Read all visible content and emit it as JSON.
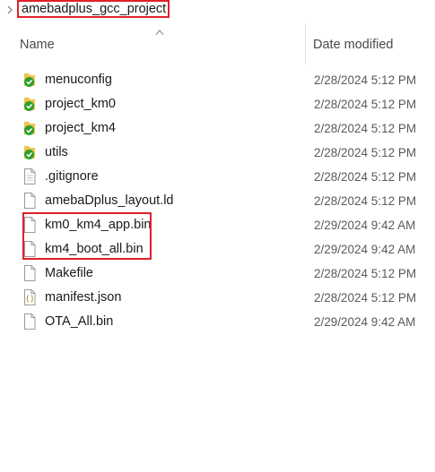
{
  "breadcrumb": {
    "folder": "amebadplus_gcc_project"
  },
  "columns": {
    "name": "Name",
    "date_modified": "Date modified"
  },
  "files": [
    {
      "name": "menuconfig",
      "date": "2/28/2024 5:12 PM",
      "icon": "folder-sync-icon"
    },
    {
      "name": "project_km0",
      "date": "2/28/2024 5:12 PM",
      "icon": "folder-sync-icon"
    },
    {
      "name": "project_km4",
      "date": "2/28/2024 5:12 PM",
      "icon": "folder-sync-icon"
    },
    {
      "name": "utils",
      "date": "2/28/2024 5:12 PM",
      "icon": "folder-sync-icon"
    },
    {
      "name": ".gitignore",
      "date": "2/28/2024 5:12 PM",
      "icon": "text-file-icon"
    },
    {
      "name": "amebaDplus_layout.ld",
      "date": "2/28/2024 5:12 PM",
      "icon": "file-icon"
    },
    {
      "name": "km0_km4_app.bin",
      "date": "2/29/2024 9:42 AM",
      "icon": "file-icon"
    },
    {
      "name": "km4_boot_all.bin",
      "date": "2/29/2024 9:42 AM",
      "icon": "file-icon"
    },
    {
      "name": "Makefile",
      "date": "2/28/2024 5:12 PM",
      "icon": "file-icon"
    },
    {
      "name": "manifest.json",
      "date": "2/28/2024 5:12 PM",
      "icon": "json-file-icon"
    },
    {
      "name": "OTA_All.bin",
      "date": "2/29/2024 9:42 AM",
      "icon": "file-icon"
    }
  ],
  "colors": {
    "highlight": "#e0202a",
    "sync_green": "#2e9e2e",
    "folder_yellow": "#f3c44a"
  }
}
